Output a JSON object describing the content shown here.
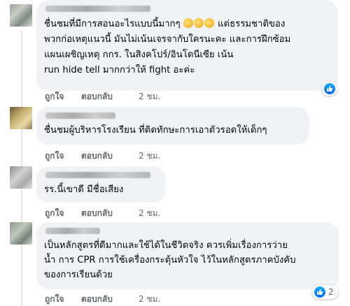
{
  "comments": [
    {
      "lines": [
        "ชื่นชมที่มีการสอนอะไรแบบนี้มากๆ",
        "พวกก่อเหตุแนวนี้ มันไม่เน้นเจรจากับใครนะคะ และการฝึกซ้อม",
        "แผนเผชิญเหตุ กกร. ในสิงคโปร์/อินโดนีเซีย เน้น",
        "run hide tell มากกว่าให้ fight อะค่ะ"
      ],
      "line1_suffix": "แต่ธรรมชาติของ",
      "emoji": "clapping-hands",
      "like_label": "ถูกใจ",
      "reply_label": "ตอบกลับ",
      "time": "2 ชม.",
      "reaction": "like"
    },
    {
      "lines": [
        "ชื่นชมผู้บริหารโรงเรียน ที่ติดทักษะการเอาตัวรอดให้เด็กๆ"
      ],
      "like_label": "ถูกใจ",
      "reply_label": "ตอบกลับ",
      "time": "2 ชม."
    },
    {
      "lines": [
        "รร.นี้เขาดี มีชื่อเสียง"
      ],
      "like_label": "ถูกใจ",
      "reply_label": "ตอบกลับ",
      "time": "2 ชม."
    },
    {
      "lines": [
        "เป็นหลักสูตรที่ดีมากและใช้ได้ในชีวิตจริง ควรเพิ่มเรื่องการว่าย",
        "น้ำ การ CPR การใช้เครื่องกระตุ้นหัวใจ ไว้ในหลักสูตรภาคบังคับ",
        "ของการเรียนด้วย"
      ],
      "like_label": "ถูกใจ",
      "reply_label": "ตอบกลับ",
      "time": "2 ชม.",
      "reaction": "like",
      "reaction_count": "2"
    }
  ],
  "colors": {
    "bubble": "#f0f2f5",
    "meta": "#65676b",
    "like_blue": "#0866ff"
  }
}
